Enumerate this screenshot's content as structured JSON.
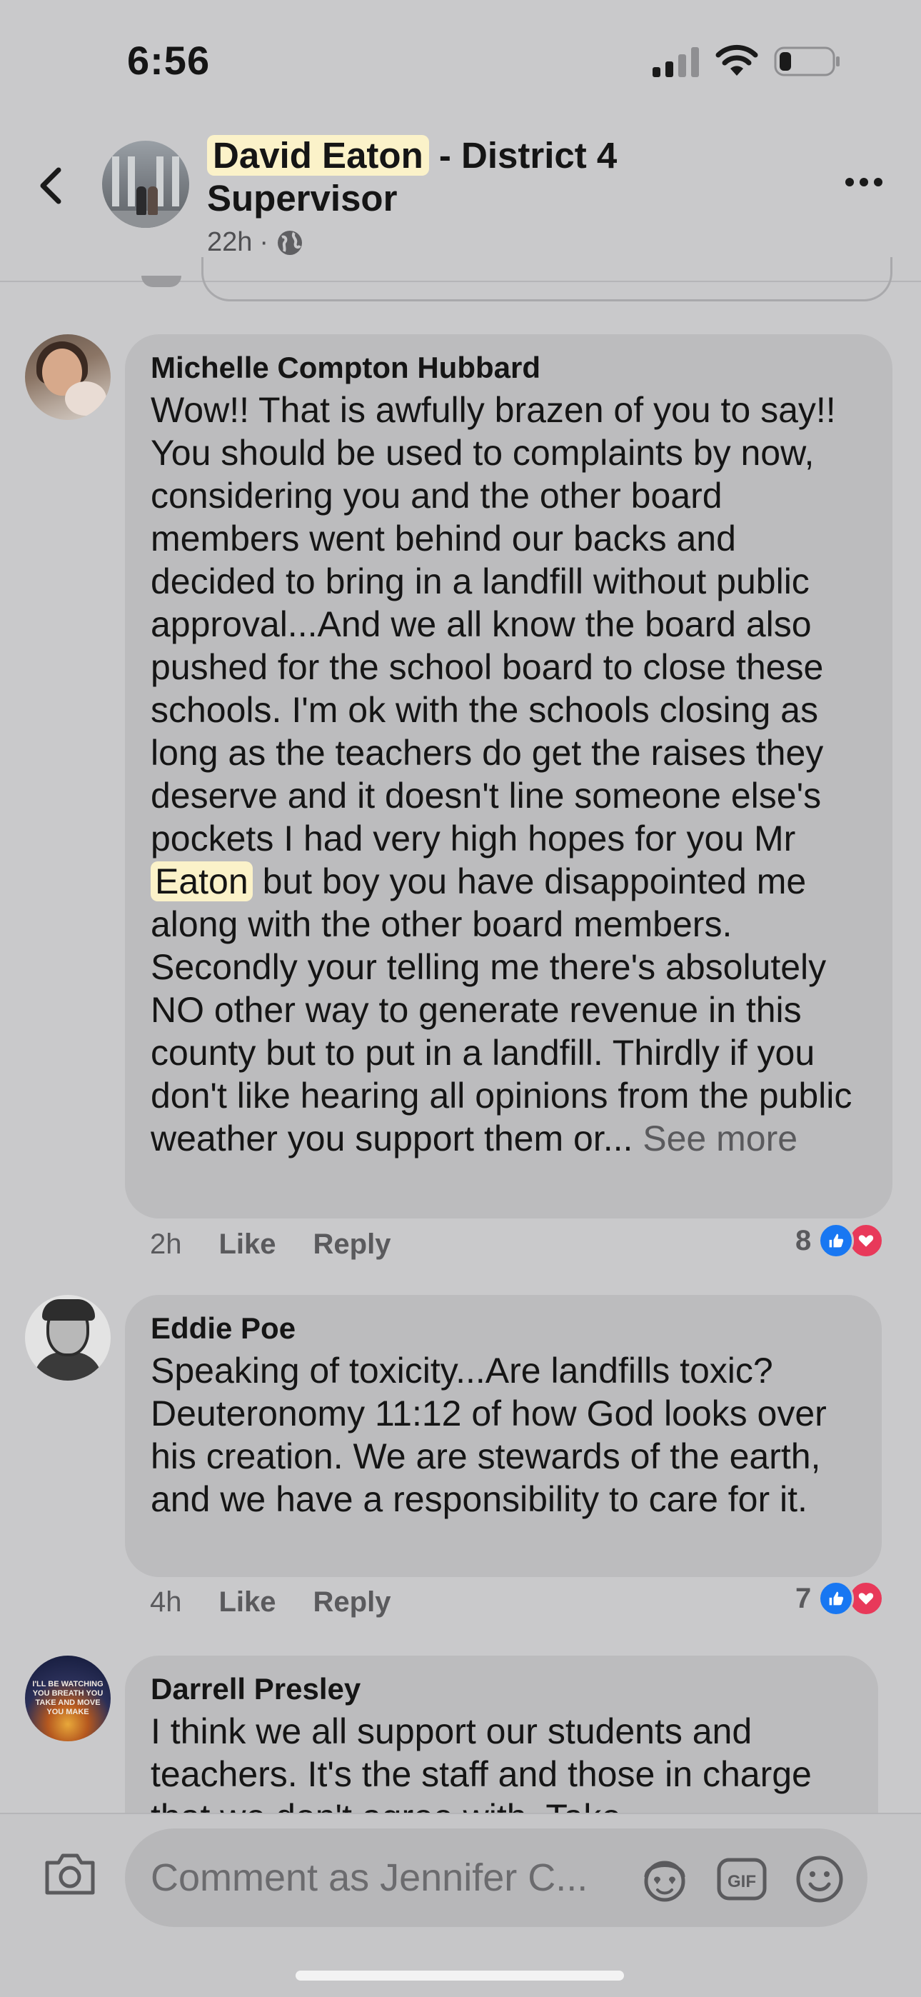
{
  "status_bar": {
    "time": "6:56"
  },
  "post_header": {
    "name_highlight": "David Eaton",
    "name_rest": " - District 4 Supervisor",
    "age": "22h",
    "separator": "·"
  },
  "comments": [
    {
      "author": "Michelle Compton Hubbard",
      "text_before": "Wow!! That is awfully brazen of you to say!! You should be used to complaints by now, considering you and the other board members went behind our backs and decided to bring in a landfill without public approval...And we all know the board also pushed for the school board to close these schools. I'm ok with the schools closing as long as the teachers do get the raises they deserve and it doesn't line someone else's pockets I had very high hopes for you Mr ",
      "highlight": "Eaton",
      "text_after": " but boy you have disappointed me along with the other board members. Secondly your telling me there's absolutely NO other way to generate revenue in this county but to put in a landfill. Thirdly if you don't like hearing all opinions from the public weather you support them or... ",
      "see_more": "See more",
      "time": "2h",
      "like": "Like",
      "reply": "Reply",
      "reactions": "8"
    },
    {
      "author": "Eddie Poe",
      "text": "Speaking of toxicity...Are landfills toxic? Deuteronomy 11:12 of how God looks over his creation. We are stewards of the earth, and we have a responsibility to care for it.",
      "time": "4h",
      "like": "Like",
      "reply": "Reply",
      "reactions": "7"
    },
    {
      "author": "Darrell Presley",
      "avatar_text": "I'LL BE WATCHING YOU BREATH YOU TAKE AND MOVE YOU MAKE",
      "text": "I think we all support our students and teachers. It's the staff and those in charge that we don't agree with. Take"
    }
  ],
  "composer": {
    "placeholder": "Comment as Jennifer C..."
  },
  "colors": {
    "like_blue": "#1877f2",
    "love_red": "#e8395a",
    "highlight": "#fbf2c9",
    "background": "#c9c9cb",
    "bubble": "#bcbcbe"
  },
  "icons": [
    "signal-icon",
    "wifi-icon",
    "battery-icon",
    "back-arrow-icon",
    "globe-icon",
    "more-icon",
    "thumbs-up-icon",
    "heart-icon",
    "camera-icon",
    "avatar-sticker-icon",
    "gif-icon",
    "emoji-icon"
  ]
}
